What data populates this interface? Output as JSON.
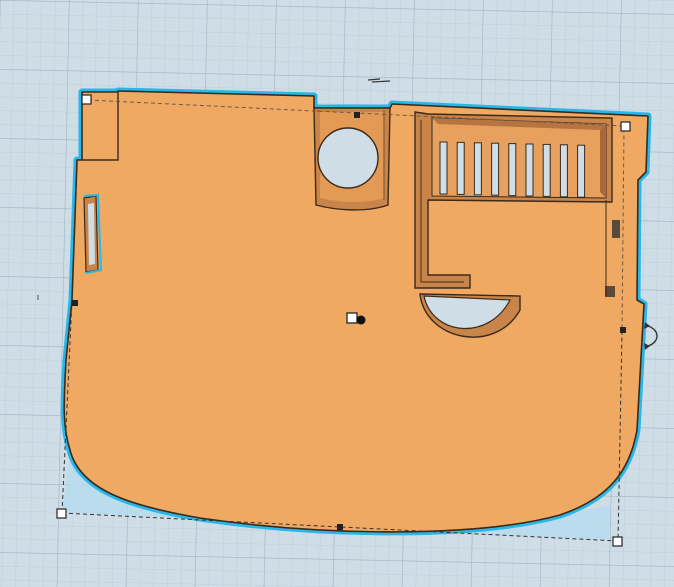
{
  "workplane": {
    "background": "#cfdde6",
    "minor_grid_color": "#b9cad6",
    "major_grid_color": "#9fb6c7"
  },
  "object": {
    "fill_color": "#f0a963",
    "inner_wall_color": "#c9844a",
    "edge_color": "#3a2a1a",
    "selection_outline_color": "#29b6e8",
    "shadow_color": "#b6dcec"
  },
  "icons": {
    "rotate_handle": "rotate-arrow-icon",
    "resize_handle": "resize-handle-icon",
    "midpoint_handle": "midpoint-handle-icon",
    "height_handle": "height-handle-icon"
  }
}
